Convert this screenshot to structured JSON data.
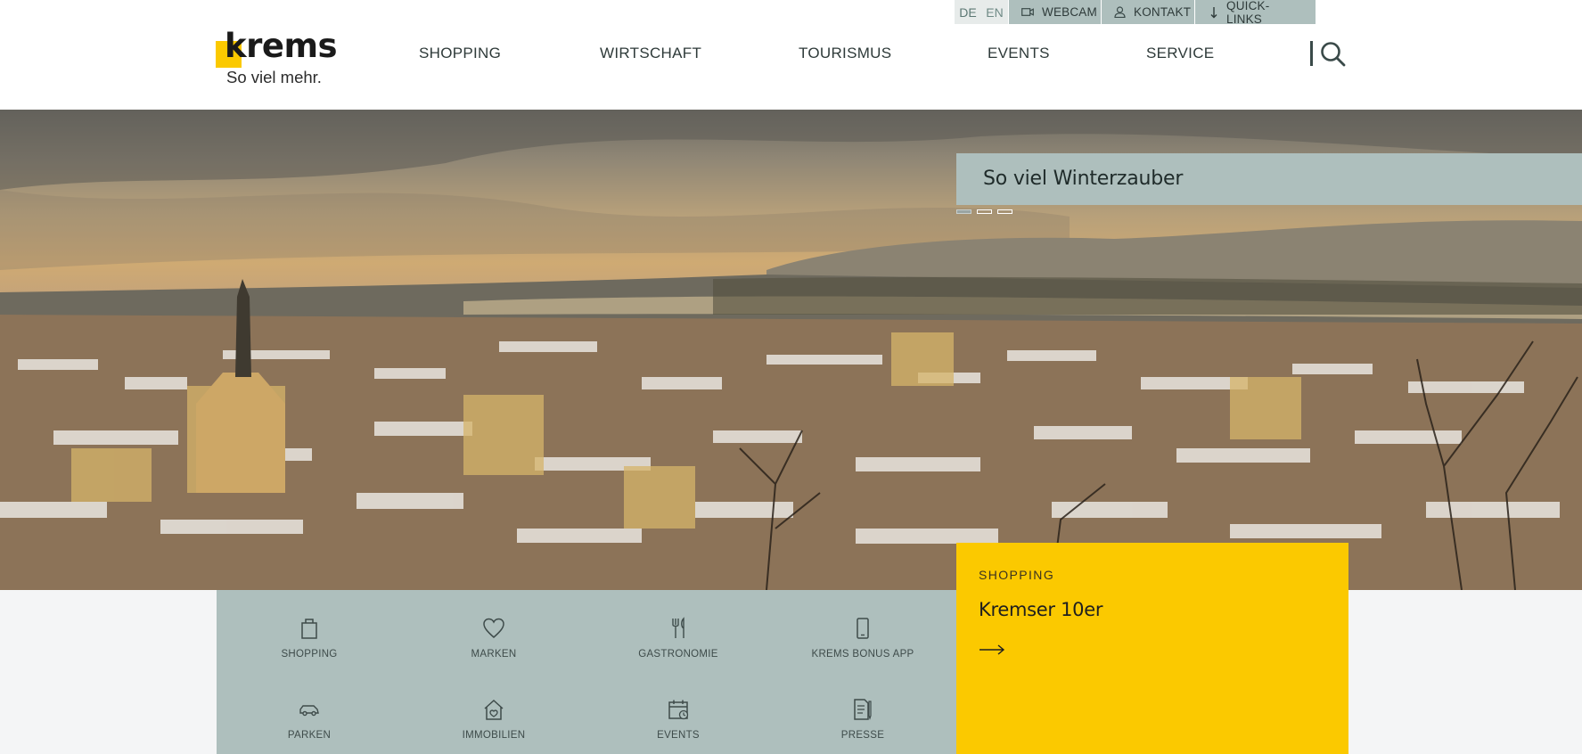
{
  "utility": {
    "languages": [
      "DE",
      "EN"
    ],
    "webcam": "WEBCAM",
    "kontakt": "KONTAKT",
    "quicklinks": "QUICK-LINKS"
  },
  "logo": {
    "word": "krems",
    "tagline": "So viel mehr."
  },
  "nav": {
    "items": [
      "SHOPPING",
      "WIRTSCHAFT",
      "TOURISMUS",
      "EVENTS",
      "SERVICE"
    ]
  },
  "hero": {
    "caption": "So viel Winterzauber",
    "slide_count": 3,
    "active_slide": 1
  },
  "quick_nav": {
    "items": [
      {
        "label": "SHOPPING",
        "icon": "shopping-bag-icon"
      },
      {
        "label": "MARKEN",
        "icon": "heart-icon"
      },
      {
        "label": "GASTRONOMIE",
        "icon": "fork-knife-icon"
      },
      {
        "label": "KREMS BONUS APP",
        "icon": "smartphone-icon"
      },
      {
        "label": "PARKEN",
        "icon": "car-icon"
      },
      {
        "label": "IMMOBILIEN",
        "icon": "house-icon"
      },
      {
        "label": "EVENTS",
        "icon": "calendar-icon"
      },
      {
        "label": "PRESSE",
        "icon": "document-icon"
      }
    ]
  },
  "teaser": {
    "category": "SHOPPING",
    "title": "Kremser 10er"
  },
  "colors": {
    "accent_yellow": "#fbc900",
    "sage": "#aebfbd",
    "text_dark": "#2e3a39"
  }
}
